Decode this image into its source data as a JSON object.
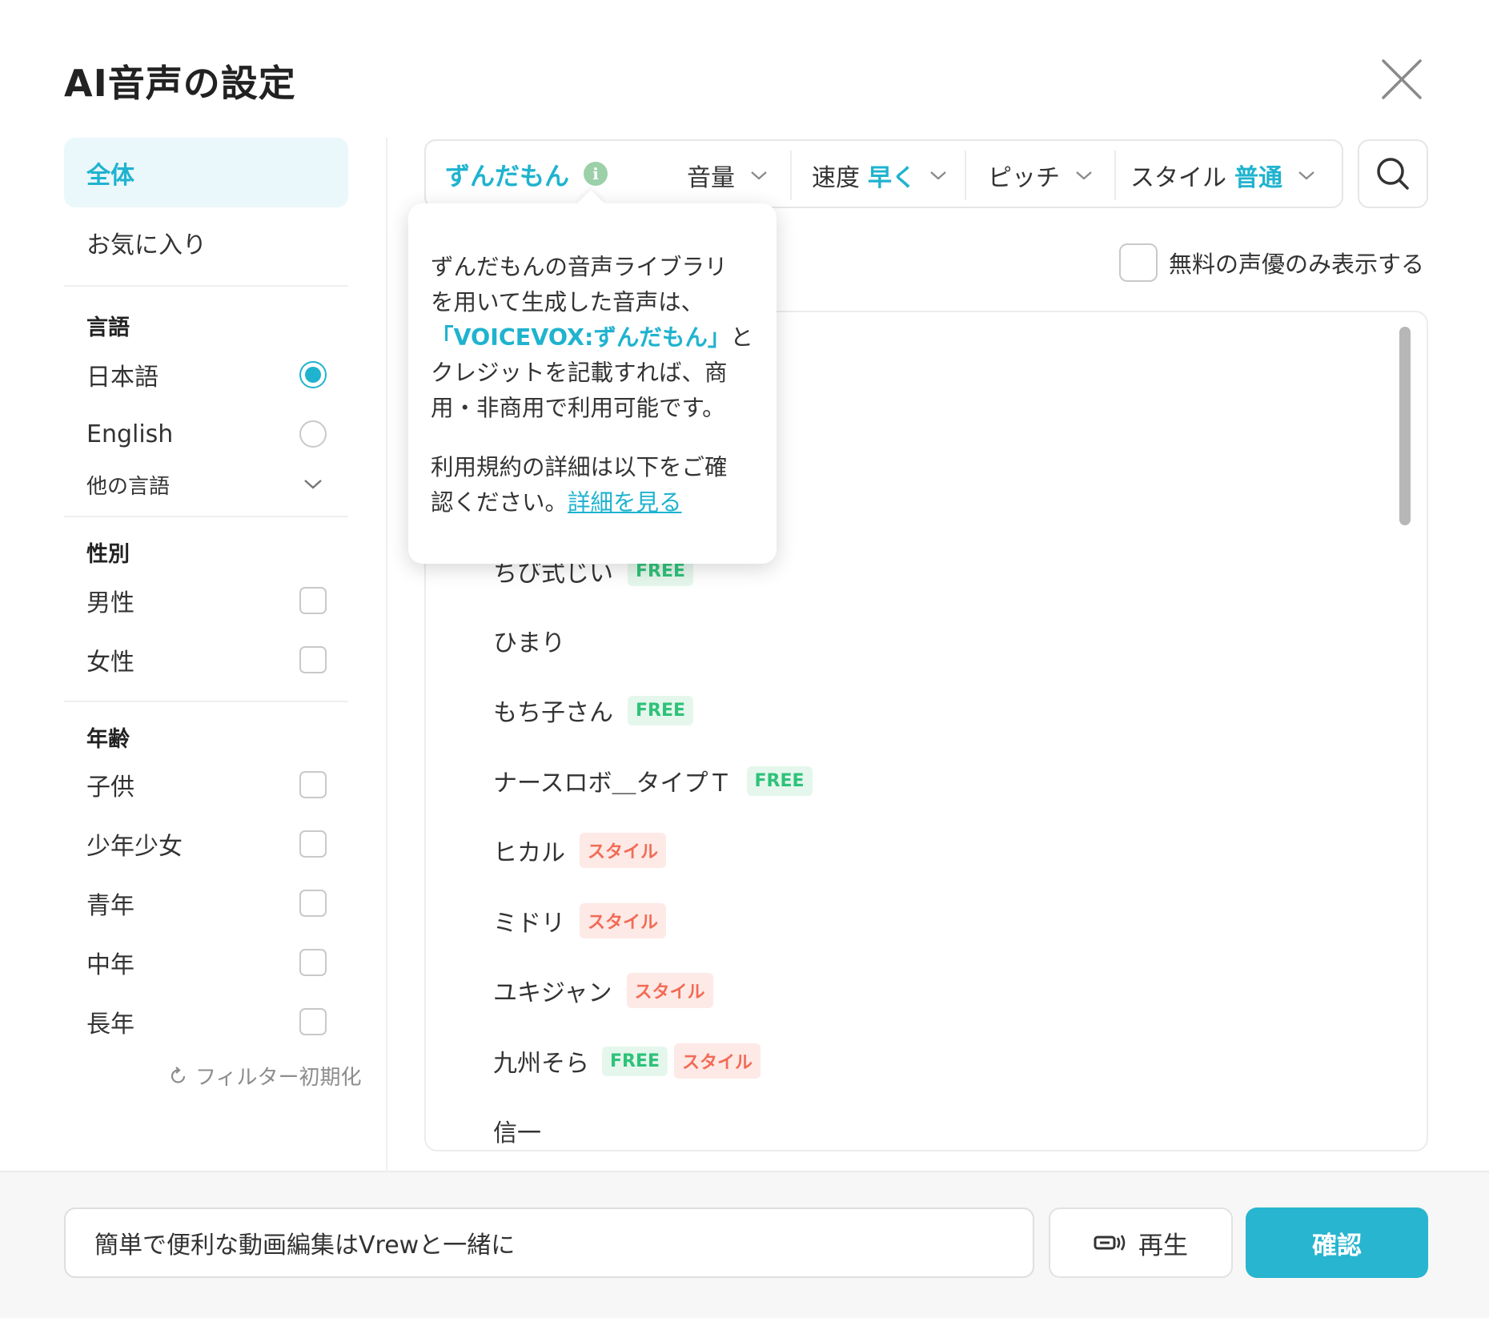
{
  "dialog": {
    "title": "AI音声の設定",
    "close_icon": "close-icon"
  },
  "sidebar": {
    "nav": [
      {
        "label": "全体",
        "active": true
      },
      {
        "label": "お気に入り",
        "active": false
      }
    ],
    "language": {
      "title": "言語",
      "options": [
        {
          "label": "日本語",
          "selected": true
        },
        {
          "label": "English",
          "selected": false
        }
      ],
      "other_label": "他の言語"
    },
    "gender": {
      "title": "性別",
      "options": [
        {
          "label": "男性",
          "checked": false
        },
        {
          "label": "女性",
          "checked": false
        }
      ]
    },
    "age": {
      "title": "年齢",
      "options": [
        {
          "label": "子供",
          "checked": false
        },
        {
          "label": "少年少女",
          "checked": false
        },
        {
          "label": "青年",
          "checked": false
        },
        {
          "label": "中年",
          "checked": false
        },
        {
          "label": "長年",
          "checked": false
        }
      ]
    },
    "reset_label": "フィルター初期化"
  },
  "toolbar": {
    "voice_name": "ずんだもん",
    "info_icon": "i",
    "volume_label": "音量",
    "speed_label": "速度",
    "speed_value": "早く",
    "pitch_label": "ピッチ",
    "style_label": "スタイル",
    "style_value": "普通"
  },
  "filter": {
    "free_only_label": "無料の声優のみ表示する"
  },
  "tooltip": {
    "line1": "ずんだもんの音声ライブラリ",
    "line2": "を用いて生成した音声は、",
    "credit": "「VOICEVOX:ずんだもん」",
    "line3_suffix": "と",
    "line4": "クレジットを記載すれば、商",
    "line5": "用・非商用で利用可能です。",
    "terms1": "利用規約の詳細は以下をご確",
    "terms2": "認ください。",
    "link": "詳細を見る"
  },
  "voices": [
    {
      "name": "ちび式じい",
      "badges": [
        "FREE"
      ]
    },
    {
      "name": "ひまり",
      "badges": []
    },
    {
      "name": "もち子さん",
      "badges": [
        "FREE"
      ]
    },
    {
      "name": "ナースロボ＿タイプＴ",
      "badges": [
        "FREE"
      ]
    },
    {
      "name": "ヒカル",
      "badges": [
        "スタイル"
      ]
    },
    {
      "name": "ミドリ",
      "badges": [
        "スタイル"
      ]
    },
    {
      "name": "ユキジャン",
      "badges": [
        "スタイル"
      ]
    },
    {
      "name": "九州そら",
      "badges": [
        "FREE",
        "スタイル"
      ]
    },
    {
      "name": "信一",
      "badges": []
    }
  ],
  "footer": {
    "input_value": "簡単で便利な動画編集はVrewと一緒に",
    "play_label": "再生",
    "confirm_label": "確認"
  },
  "colors": {
    "accent": "#1fb3cf",
    "free_badge": "#2ec27a",
    "style_badge": "#f26b55"
  }
}
